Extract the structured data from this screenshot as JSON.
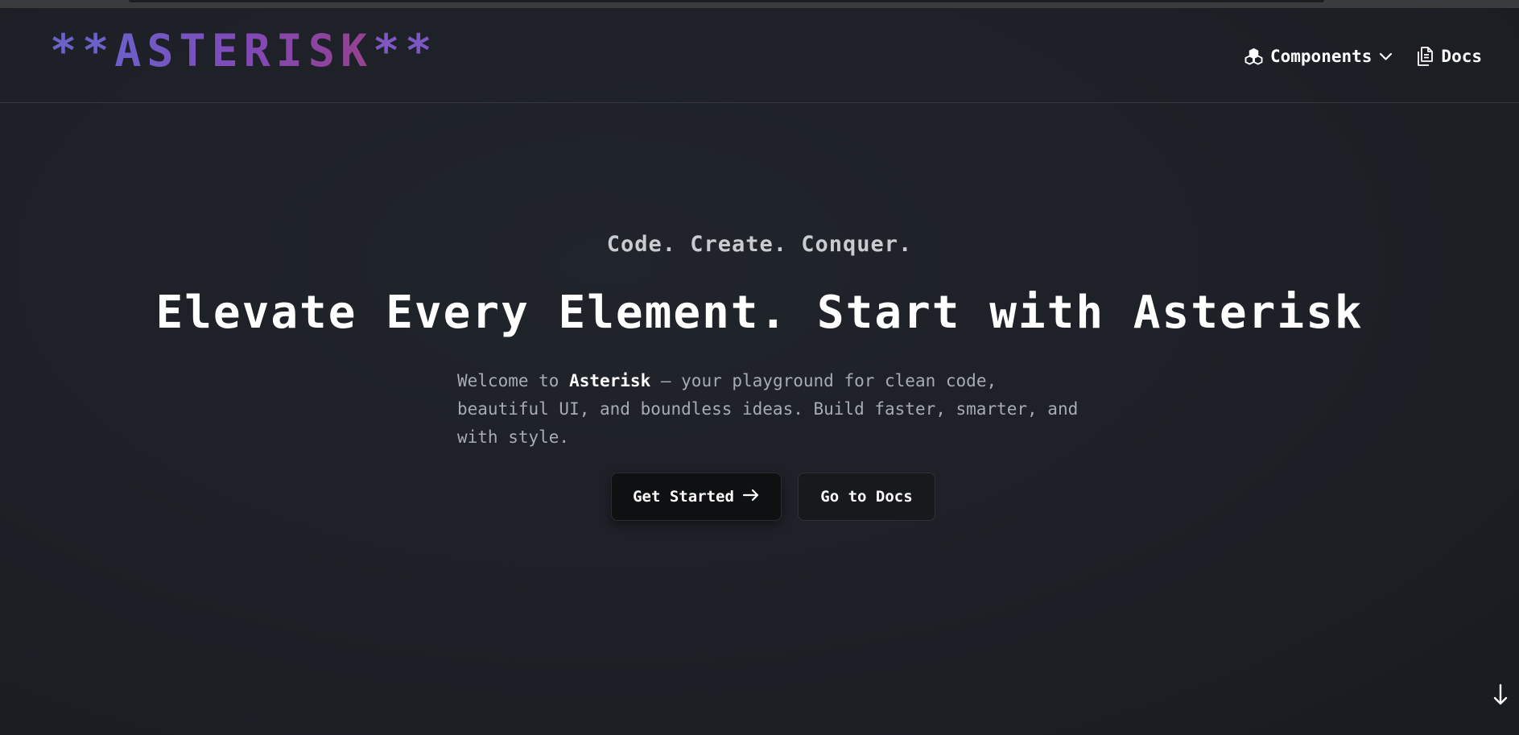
{
  "header": {
    "logo": {
      "star_left": "**",
      "word": "ASTERISK",
      "star_right": "**"
    },
    "nav": {
      "components_label": "Components",
      "docs_label": "Docs"
    }
  },
  "hero": {
    "tagline": "Code. Create. Conquer.",
    "headline": "Elevate Every Element. Start with Asterisk",
    "subtext_prefix": "Welcome to ",
    "subtext_brand": "Asterisk",
    "subtext_rest": " — your playground for clean code, beautiful UI, and boundless ideas. Build faster, smarter, and with style."
  },
  "actions": {
    "primary_label": "Get Started",
    "secondary_label": "Go to Docs"
  },
  "icons": {
    "components": "cubes-icon",
    "chevron": "chevron-down-icon",
    "docs": "documents-icon",
    "arrow": "arrow-right-icon",
    "scroll": "arrow-down-icon"
  },
  "colors": {
    "background": "#1e2127",
    "logo_gradient_start": "#6c5fca",
    "logo_gradient_end": "#96418e",
    "text_primary": "#ffffff",
    "text_muted": "#a7abb3",
    "button_primary_bg": "#0f1012"
  }
}
